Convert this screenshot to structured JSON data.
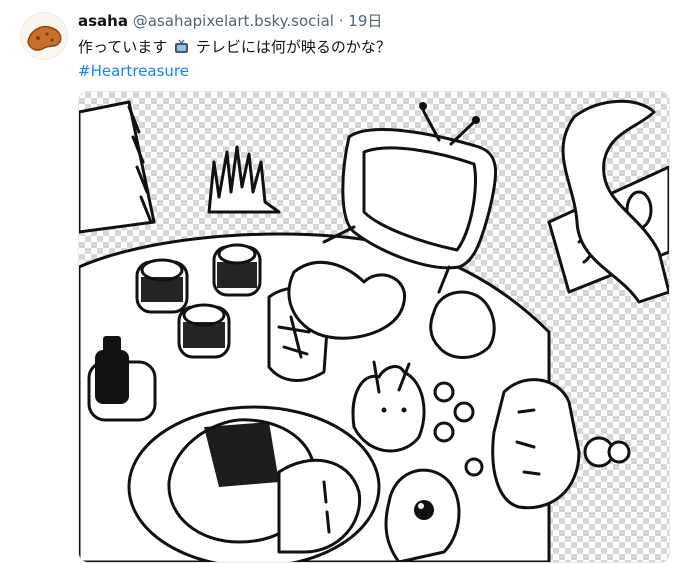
{
  "post": {
    "author_name": "asaha",
    "author_handle": "@asahapixelart.bsky.social",
    "separator": "·",
    "time": "19日",
    "text_before_emoji": "作っています",
    "emoji_name": "tv-icon",
    "text_after_emoji": "テレビには何が映るのかな？",
    "hashtag": "#Heartreasure"
  },
  "media": {
    "kind": "drawing"
  }
}
